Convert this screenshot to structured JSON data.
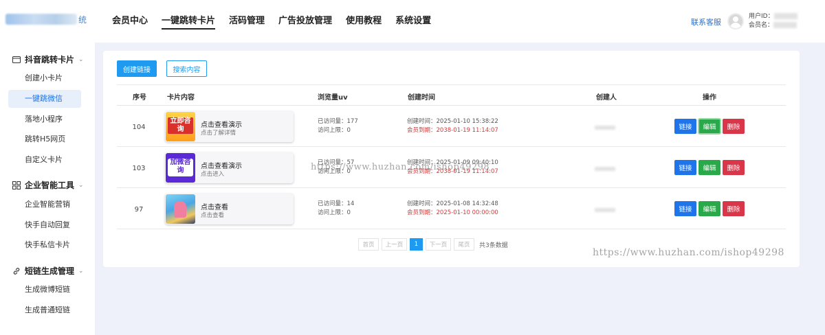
{
  "header": {
    "logo_text": "统",
    "nav": [
      "会员中心",
      "一键跳转卡片",
      "活码管理",
      "广告投放管理",
      "使用教程",
      "系统设置"
    ],
    "active_nav": 1,
    "contact": "联系客服",
    "user_id_label": "用户ID：",
    "member_name_label": "会员名："
  },
  "sidebar": {
    "groups": [
      {
        "title": "抖音跳转卡片",
        "icon": "card-icon",
        "items": [
          "创建小卡片",
          "一键跳微信",
          "落地小程序",
          "跳转H5网页",
          "自定义卡片"
        ]
      },
      {
        "title": "企业智能工具",
        "icon": "grid-icon",
        "items": [
          "企业智能营销",
          "快手自动回复",
          "快手私信卡片"
        ]
      },
      {
        "title": "短链生成管理",
        "icon": "link-icon",
        "items": [
          "生成微博短链",
          "生成普通短链"
        ]
      }
    ],
    "active_item": "一键跳微信"
  },
  "toolbar": {
    "create": "创建链接",
    "search": "搜索内容"
  },
  "table": {
    "headers": [
      "序号",
      "卡片内容",
      "浏览量uv",
      "创建时间",
      "创建人",
      "操作"
    ],
    "rows": [
      {
        "id": "104",
        "title": "点击查看演示",
        "subtitle": "点击了解详情",
        "thumb": "立即咨询",
        "visits": "已访问量：177",
        "limit": "访问上限：0",
        "created": "创建时间：2025-01-10 15:38:22",
        "expire": "会员到期：2038-01-19 11:14:07"
      },
      {
        "id": "103",
        "title": "点击查看演示",
        "subtitle": "点击进入",
        "thumb": "加微咨询",
        "visits": "已访问量：57",
        "limit": "访问上限：0",
        "created": "创建时间：2025-01-09 09:40:10",
        "expire": "会员到期：2038-01-19 11:14:07"
      },
      {
        "id": "97",
        "title": "点击查看",
        "subtitle": "点击查看",
        "thumb": "",
        "visits": "已访问量：14",
        "limit": "访问上限：0",
        "created": "创建时间：2025-01-08 14:32:48",
        "expire": "会员到期：2025-01-10 00:00:00"
      }
    ],
    "actions": [
      "链接",
      "编辑",
      "删除"
    ]
  },
  "pagination": {
    "first": "首页",
    "prev": "上一页",
    "current": "1",
    "next": "下一页",
    "last": "尾页",
    "total": "共3条数据"
  },
  "watermark": "https://www.huzhan.com/ishop49298",
  "colors": {
    "primary": "#1e9bf0",
    "link_btn": "#1e74e8",
    "edit_btn": "#2aa94a",
    "delete_btn": "#d9364a",
    "expire_text": "#d23b3b"
  }
}
